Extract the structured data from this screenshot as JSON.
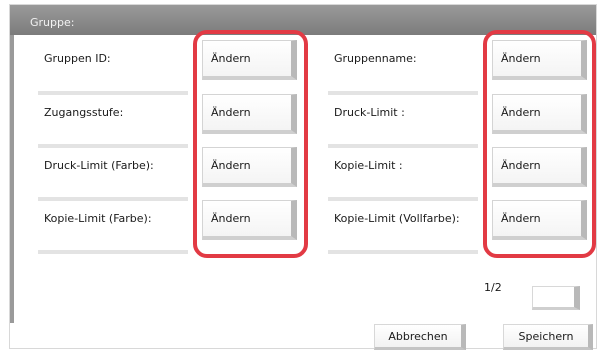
{
  "window": {
    "title": "Gruppe:"
  },
  "fields": [
    {
      "label": "Gruppen ID:",
      "button": "Ändern"
    },
    {
      "label": "Zugangsstufe:",
      "button": "Ändern"
    },
    {
      "label": "Druck-Limit (Farbe):",
      "button": "Ändern"
    },
    {
      "label": "Kopie-Limit (Farbe):",
      "button": "Ändern"
    },
    {
      "label": "Gruppenname:",
      "button": "Ändern"
    },
    {
      "label": "Druck-Limit :",
      "button": "Ändern"
    },
    {
      "label": "Kopie-Limit :",
      "button": "Ändern"
    },
    {
      "label": "Kopie-Limit (Vollfarbe):",
      "button": "Ändern"
    }
  ],
  "pagination": {
    "indicator": "1/2"
  },
  "footer": {
    "cancel_label": "Abbrechen",
    "save_label": "Speichern"
  },
  "colors": {
    "highlight": "#e23a44",
    "titlebar": "#8a8a8a"
  }
}
